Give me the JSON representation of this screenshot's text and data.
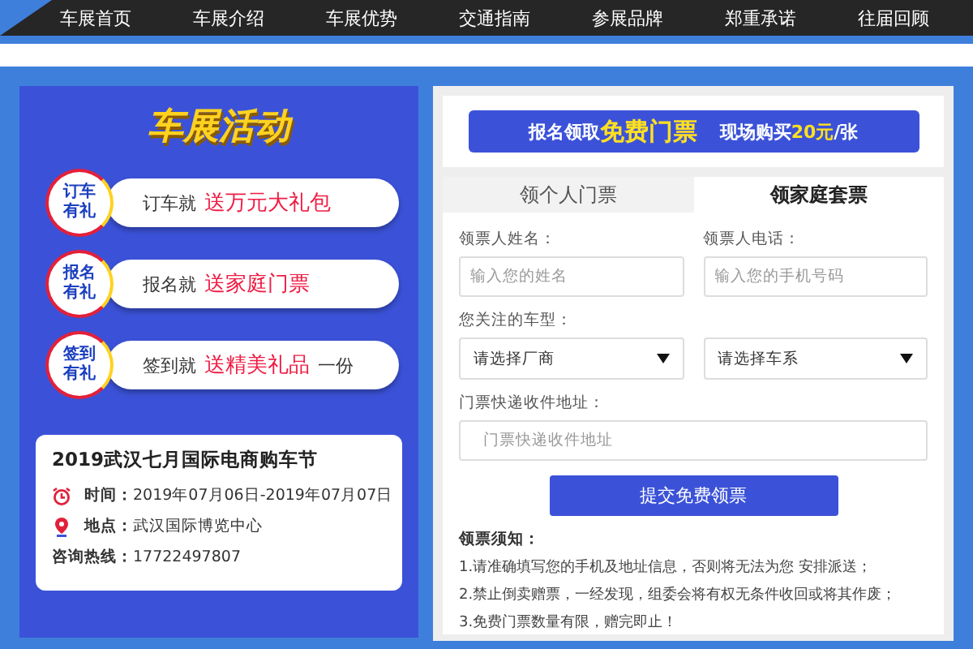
{
  "nav": {
    "items": [
      "车展首页",
      "车展介绍",
      "车展优势",
      "交通指南",
      "参展品牌",
      "郑重承诺",
      "往届回顾"
    ]
  },
  "activities": {
    "title": "车展活动",
    "items": [
      {
        "badge_top": "订车",
        "badge_bottom": "有礼",
        "lead": "订车就",
        "highlight": "送万元大礼包"
      },
      {
        "badge_top": "报名",
        "badge_bottom": "有礼",
        "lead": "报名就",
        "highlight": "送家庭门票"
      },
      {
        "badge_top": "签到",
        "badge_bottom": "有礼",
        "lead": "签到就",
        "highlight": "送精美礼品",
        "tail": "一份"
      }
    ]
  },
  "event": {
    "title": "2019武汉七月国际电商购车节",
    "time_label": "时间：",
    "time": "2019年07月06日-2019年07月07日",
    "place_label": "地点：",
    "place": "武汉国际博览中心",
    "hotline_label": "咨询热线：",
    "hotline": "17722497807"
  },
  "banner": {
    "prefix": "报名领取",
    "free": "免费门票",
    "onsite": "现场购买",
    "price": "20元",
    "unit": "/张"
  },
  "tabs": [
    {
      "label": "领个人门票",
      "selected": false
    },
    {
      "label": "领家庭套票",
      "selected": true
    }
  ],
  "form": {
    "name_label": "领票人姓名：",
    "name_placeholder": "输入您的姓名",
    "phone_label": "领票人电话：",
    "phone_placeholder": "输入您的手机号码",
    "car_label": "您关注的车型：",
    "maker_select": "请选择厂商",
    "series_select": "请选择车系",
    "address_label": "门票快递收件地址：",
    "address_placeholder": "门票快递收件地址",
    "submit": "提交免费领票"
  },
  "notes": {
    "title": "领票须知：",
    "lines": [
      "1.请准确填写您的手机及地址信息，否则将无法为您 安排派送；",
      "2.禁止倒卖赠票，一经发现，组委会将有权无条件收回或将其作废；",
      "3.免费门票数量有限，赠完即止！"
    ]
  }
}
